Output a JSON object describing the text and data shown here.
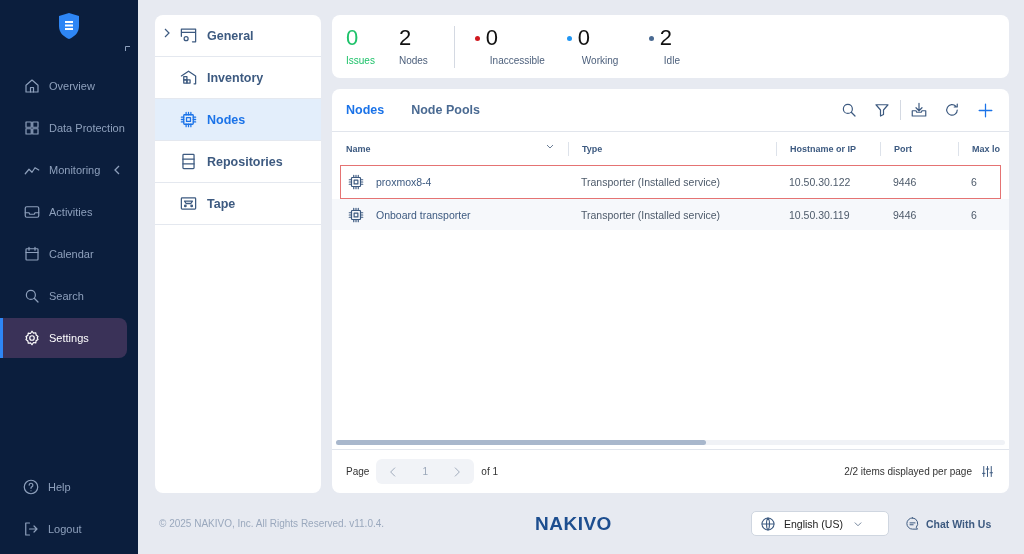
{
  "sidebar": {
    "items": [
      {
        "label": "Overview",
        "selected": false,
        "expandable": false
      },
      {
        "label": "Data Protection",
        "selected": false,
        "expandable": false
      },
      {
        "label": "Monitoring",
        "selected": false,
        "expandable": true
      },
      {
        "label": "Activities",
        "selected": false,
        "expandable": false
      },
      {
        "label": "Calendar",
        "selected": false,
        "expandable": false
      },
      {
        "label": "Search",
        "selected": false,
        "expandable": false
      },
      {
        "label": "Settings",
        "selected": true,
        "expandable": false
      }
    ],
    "bottom_items": [
      {
        "label": "Help"
      },
      {
        "label": "Logout"
      }
    ]
  },
  "settings_nav": {
    "items": [
      {
        "label": "General",
        "selected": false,
        "expandable": true
      },
      {
        "label": "Inventory",
        "selected": false,
        "expandable": false
      },
      {
        "label": "Nodes",
        "selected": true,
        "expandable": false
      },
      {
        "label": "Repositories",
        "selected": false,
        "expandable": false
      },
      {
        "label": "Tape",
        "selected": false,
        "expandable": false
      }
    ]
  },
  "summary": {
    "issues": {
      "value": "0",
      "label": "Issues"
    },
    "nodes": {
      "value": "2",
      "label": "Nodes"
    },
    "statuses": [
      {
        "value": "0",
        "label": "Inaccessible",
        "color": "#d0191f"
      },
      {
        "value": "0",
        "label": "Working",
        "color": "#2196f3"
      },
      {
        "value": "2",
        "label": "Idle",
        "color": "#4a6a92"
      }
    ]
  },
  "tabs": [
    {
      "label": "Nodes",
      "selected": true
    },
    {
      "label": "Node Pools",
      "selected": false
    }
  ],
  "table": {
    "columns": [
      "Name",
      "Type",
      "Hostname or IP",
      "Port",
      "Max lo"
    ],
    "rows": [
      {
        "name": "proxmox8-4",
        "type": "Transporter (Installed service)",
        "host": "10.50.30.122",
        "port": "9446",
        "max": "6",
        "highlighted": true
      },
      {
        "name": "Onboard transporter",
        "type": "Transporter (Installed service)",
        "host": "10.50.30.119",
        "port": "9446",
        "max": "6",
        "highlighted": false
      }
    ]
  },
  "pagination": {
    "label": "Page",
    "page": "1",
    "of": "of 1",
    "items_text": "2/2 items displayed per page"
  },
  "footer": {
    "copyright": "© 2025 NAKIVO, Inc. All Rights Reserved. v11.0.4.",
    "logo": "NAKIVO",
    "language": "English (US)",
    "chat": "Chat With Us"
  }
}
